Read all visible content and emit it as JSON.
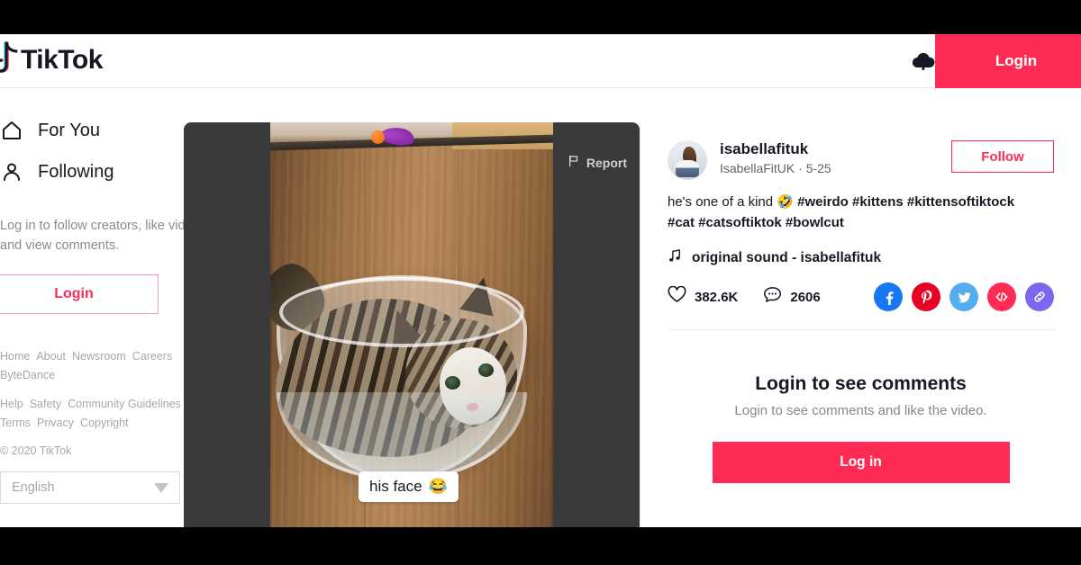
{
  "header": {
    "logo_text": "TikTok",
    "logo_icon": "tiktok-note-icon",
    "upload_icon": "cloud-upload-icon",
    "login_label": "Login"
  },
  "sidebar": {
    "nav": [
      {
        "label": "For You",
        "icon": "home-icon"
      },
      {
        "label": "Following",
        "icon": "person-icon"
      }
    ],
    "promo_text": "Log in to follow creators, like videos, and view comments.",
    "login_label": "Login",
    "footer_rows": [
      [
        "Home",
        "About",
        "Newsroom",
        "Careers"
      ],
      [
        "ByteDance"
      ],
      [
        "Help",
        "Safety",
        "Community Guidelines"
      ],
      [
        "Terms",
        "Privacy",
        "Copyright"
      ]
    ],
    "copyright": "© 2020 TikTok",
    "language": "English",
    "language_caret": "chevron-down-icon"
  },
  "video": {
    "report_label": "Report",
    "report_icon": "flag-icon",
    "overlay_text": "his face",
    "overlay_emoji": "😂"
  },
  "post": {
    "username": "isabellafituk",
    "nickname": "IsabellaFitUK · 5-25",
    "follow_label": "Follow",
    "caption_prefix": "he's one of a kind ",
    "caption_emoji": "🤣",
    "hashtags": [
      "#weirdo",
      "#kittens",
      "#kittensoftiktock",
      "#cat",
      "#catsoftiktok",
      "#bowlcut"
    ],
    "music_icon": "music-note-icon",
    "music_title": "original sound - isabellafituk",
    "like_icon": "heart-icon",
    "like_count": "382.6K",
    "comment_icon": "comment-bubble-icon",
    "comment_count": "2606",
    "share_icons": [
      {
        "name": "facebook-share-icon",
        "glyph": "f",
        "color": "#1877f2"
      },
      {
        "name": "pinterest-share-icon",
        "glyph": "P",
        "color": "#e60023"
      },
      {
        "name": "twitter-share-icon",
        "glyph": "t",
        "color": "#55acee"
      },
      {
        "name": "embed-code-icon",
        "glyph": "</>",
        "color": "#fe2c55"
      },
      {
        "name": "copy-link-icon",
        "glyph": "🔗",
        "color": "#7b68ee"
      }
    ]
  },
  "comments": {
    "title": "Login to see comments",
    "subtitle": "Login to see comments and like the video.",
    "login_label": "Log in"
  },
  "colors": {
    "brand_red": "#fe2c55",
    "text_dark": "#161823",
    "text_muted": "#a6a7ab",
    "letterbox": "#3a3a3a"
  }
}
